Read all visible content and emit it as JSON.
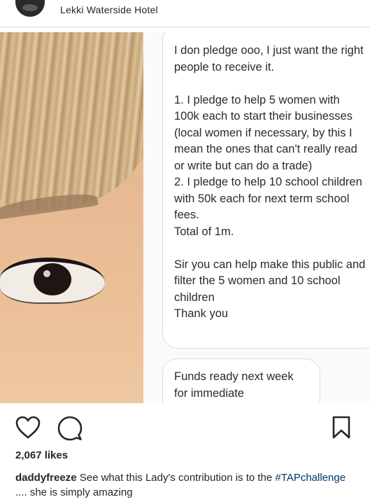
{
  "header": {
    "location": "Lekki Waterside Hotel"
  },
  "post": {
    "message1": {
      "line_intro": "I don pledge ooo, I just want the right people to receive it.",
      "pledge1": "1. I pledge to help 5 women with 100k each to start their businesses (local women if necessary, by this I mean the ones that can't really read or write but can do a trade)",
      "pledge2": "2. I pledge to help 10 school children with 50k each for next term school fees.",
      "total": "Total of 1m.",
      "request": "Sir you can help make this public and filter the 5 women and 10 school children",
      "thanks": "Thank you"
    },
    "message2": "Funds ready next week for immediate implementation"
  },
  "actions": {
    "like_icon": "heart-icon",
    "comment_icon": "comment-icon",
    "save_icon": "bookmark-icon"
  },
  "likes": "2,067 likes",
  "caption": {
    "username": "daddyfreeze",
    "text_before": "See what this Lady's contribution is to the",
    "hashtag": "#TAPchallenge",
    "text_after": ".... she is simply amazing"
  },
  "colors": {
    "hashtag": "#003569",
    "bubble_border": "#dcdcdc"
  }
}
